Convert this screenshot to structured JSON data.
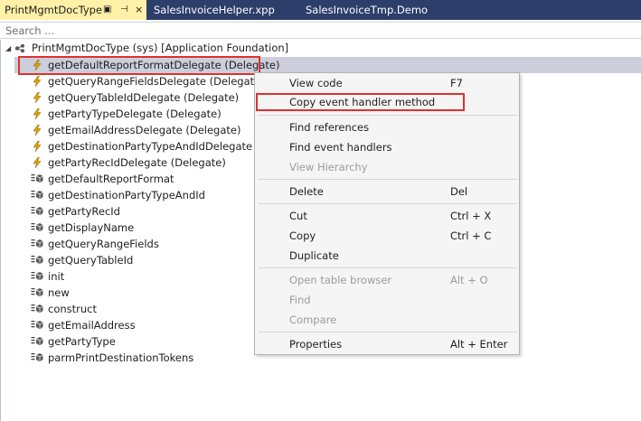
{
  "tabs": {
    "active": {
      "label": "PrintMgmtDocType",
      "pin_icon": "▣",
      "pin2_icon": "⊣",
      "close_icon": "×"
    },
    "second": {
      "label": "SalesInvoiceHelper.xpp"
    },
    "third": {
      "label": "SalesInvoiceTmp.Demo"
    }
  },
  "search": {
    "placeholder": "Search ..."
  },
  "tree": {
    "root_label": "PrintMgmtDocType (sys) [Application Foundation]",
    "items": [
      {
        "label": "getDefaultReportFormatDelegate (Delegate)",
        "icon": "delegate-icon"
      },
      {
        "label": "getQueryRangeFieldsDelegate (Delegate)",
        "icon": "delegate-icon"
      },
      {
        "label": "getQueryTableIdDelegate (Delegate)",
        "icon": "delegate-icon"
      },
      {
        "label": "getPartyTypeDelegate (Delegate)",
        "icon": "delegate-icon"
      },
      {
        "label": "getEmailAddressDelegate (Delegate)",
        "icon": "delegate-icon"
      },
      {
        "label": "getDestinationPartyTypeAndIdDelegate (Dele",
        "icon": "delegate-icon"
      },
      {
        "label": "getPartyRecIdDelegate (Delegate)",
        "icon": "delegate-icon"
      },
      {
        "label": "getDefaultReportFormat",
        "icon": "method-icon"
      },
      {
        "label": "getDestinationPartyTypeAndId",
        "icon": "method-icon"
      },
      {
        "label": "getPartyRecId",
        "icon": "method-icon"
      },
      {
        "label": "getDisplayName",
        "icon": "method-icon"
      },
      {
        "label": "getQueryRangeFields",
        "icon": "method-icon"
      },
      {
        "label": "getQueryTableId",
        "icon": "method-icon"
      },
      {
        "label": "init",
        "icon": "method-icon"
      },
      {
        "label": "new",
        "icon": "method-icon"
      },
      {
        "label": "construct",
        "icon": "method-icon"
      },
      {
        "label": "getEmailAddress",
        "icon": "method-icon"
      },
      {
        "label": "getPartyType",
        "icon": "method-icon"
      },
      {
        "label": "parmPrintDestinationTokens",
        "icon": "method-icon"
      }
    ]
  },
  "context_menu": {
    "view_code": {
      "label": "View code",
      "shortcut": "F7"
    },
    "copy_event_handler": {
      "label": "Copy event handler method"
    },
    "find_references": {
      "label": "Find references"
    },
    "find_event_handlers": {
      "label": "Find event handlers"
    },
    "view_hierarchy": {
      "label": "View Hierarchy"
    },
    "delete": {
      "label": "Delete",
      "shortcut": "Del"
    },
    "cut": {
      "label": "Cut",
      "shortcut": "Ctrl + X"
    },
    "copy": {
      "label": "Copy",
      "shortcut": "Ctrl + C"
    },
    "duplicate": {
      "label": "Duplicate"
    },
    "open_table_browser": {
      "label": "Open table browser",
      "shortcut": "Alt + O"
    },
    "find": {
      "label": "Find"
    },
    "compare": {
      "label": "Compare"
    },
    "properties": {
      "label": "Properties",
      "shortcut": "Alt + Enter"
    }
  },
  "colors": {
    "tab_strip": "#2d3e6b",
    "active_tab": "#fff1a8",
    "selection": "#cccedb",
    "highlight_border": "#e0312c",
    "delegate_bolt": "#e3a400"
  }
}
